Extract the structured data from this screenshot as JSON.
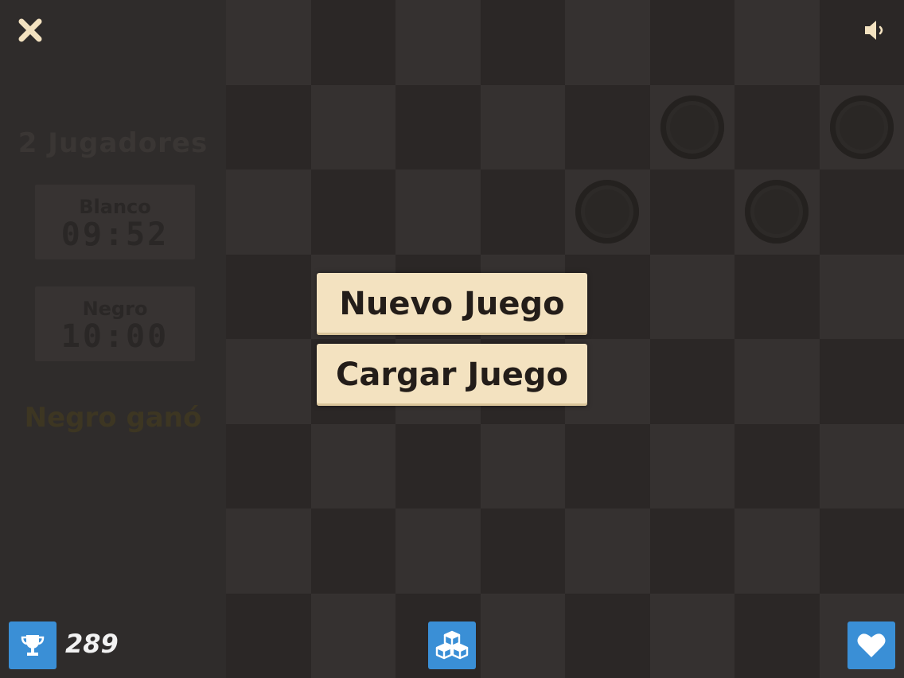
{
  "left_panel": {
    "mode_title": "2 Jugadores",
    "white_timer": {
      "label": "Blanco",
      "time": "09:52"
    },
    "black_timer": {
      "label": "Negro",
      "time": "10:00"
    },
    "status": "Negro ganó"
  },
  "menu": {
    "new_game": "Nuevo Juego",
    "load_game": "Cargar Juego"
  },
  "footer": {
    "score": "289"
  },
  "icons": {
    "close": "close-icon",
    "sound": "speaker-icon",
    "trophy": "trophy-icon",
    "blocks": "cubes-icon",
    "heart": "heart-icon"
  },
  "colors": {
    "accent_blue": "#3a8fd6",
    "button_cream": "#f3e2c0",
    "close_icon": "#f3e2c0"
  }
}
